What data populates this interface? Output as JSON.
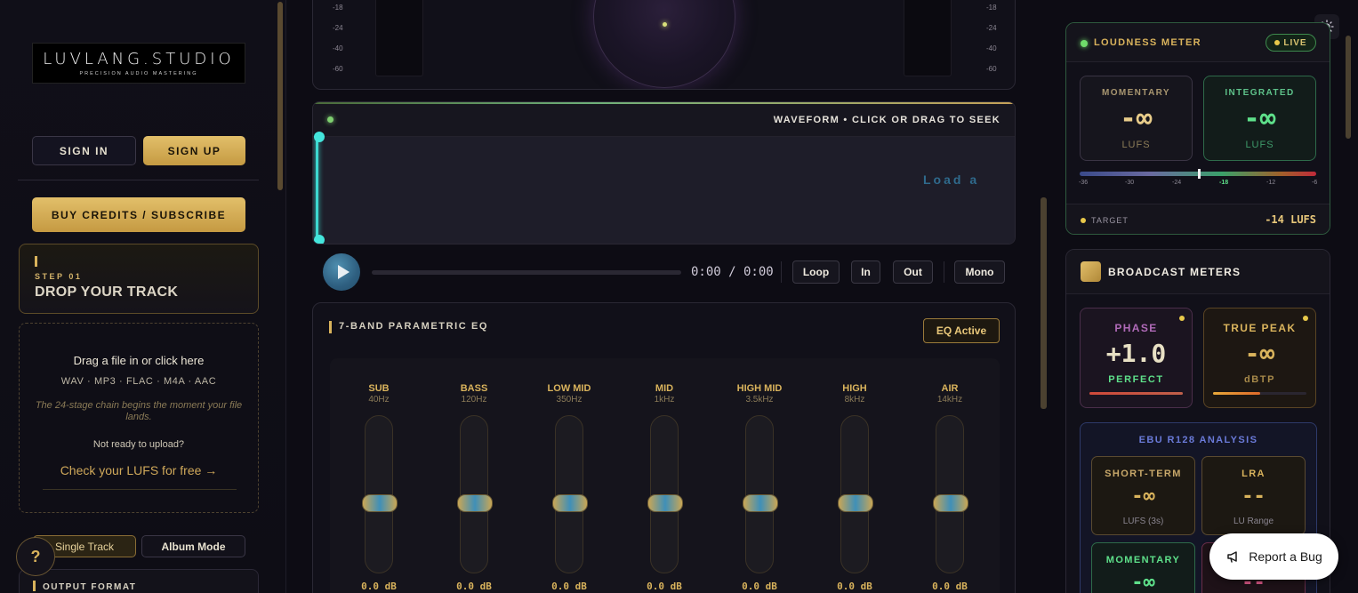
{
  "sidebar": {
    "logo_text": "LUVLANG.STUDIO",
    "logo_sub": "PRECISION AUDIO MASTERING",
    "sign_in": "SIGN IN",
    "sign_up": "SIGN UP",
    "buy_credits": "BUY CREDITS / SUBSCRIBE",
    "step_label": "STEP 01",
    "step_title": "DROP YOUR TRACK",
    "drop_title": "Drag a file in or click here",
    "drop_formats": "WAV · MP3 · FLAC · M4A · AAC",
    "drop_note": "The 24-stage chain begins the moment your file lands.",
    "drop_ready": "Not ready to upload?",
    "drop_link": "Check your LUFS for free →",
    "help": "?",
    "single_track": "Single Track",
    "album_mode": "Album Mode",
    "output_format": "OUTPUT FORMAT"
  },
  "meters": {
    "scale_left": [
      "-18",
      "-24",
      "-40",
      "-60"
    ],
    "scale_right": [
      "-18",
      "-24",
      "-40",
      "-60"
    ]
  },
  "waveform": {
    "title": "WAVEFORM • CLICK OR DRAG TO SEEK",
    "load_text": "Load a"
  },
  "transport": {
    "time": "0:00 / 0:00",
    "loop": "Loop",
    "in": "In",
    "out": "Out",
    "mono": "Mono"
  },
  "eq": {
    "title": "7-BAND PARAMETRIC EQ",
    "status": "EQ Active",
    "bands": [
      {
        "name": "SUB",
        "freq": "40Hz",
        "value": "0.0 dB"
      },
      {
        "name": "BASS",
        "freq": "120Hz",
        "value": "0.0 dB"
      },
      {
        "name": "LOW MID",
        "freq": "350Hz",
        "value": "0.0 dB"
      },
      {
        "name": "MID",
        "freq": "1kHz",
        "value": "0.0 dB"
      },
      {
        "name": "HIGH MID",
        "freq": "3.5kHz",
        "value": "0.0 dB"
      },
      {
        "name": "HIGH",
        "freq": "8kHz",
        "value": "0.0 dB"
      },
      {
        "name": "AIR",
        "freq": "14kHz",
        "value": "0.0 dB"
      }
    ]
  },
  "loudness": {
    "title": "LOUDNESS METER",
    "live": "LIVE",
    "momentary_label": "MOMENTARY",
    "momentary_value": "-∞",
    "momentary_unit": "LUFS",
    "integrated_label": "INTEGRATED",
    "integrated_value": "-∞",
    "integrated_unit": "LUFS",
    "scale_ticks": [
      "-36",
      "-30",
      "-24",
      "-18",
      "-12",
      "-6"
    ],
    "target_label": "TARGET",
    "target_value": "-14 LUFS"
  },
  "broadcast": {
    "title": "BROADCAST METERS",
    "phase_label": "PHASE",
    "phase_value": "+1.0",
    "phase_status": "PERFECT",
    "truepeak_label": "TRUE PEAK",
    "truepeak_value": "-∞",
    "truepeak_unit": "dBTP",
    "ebu_title": "EBU R128 ANALYSIS",
    "short_term_label": "SHORT-TERM",
    "short_term_value": "-∞",
    "short_term_unit": "LUFS (3s)",
    "lra_label": "LRA",
    "lra_value": "--",
    "lra_unit": "LU Range",
    "momentary_label": "MOMENTARY",
    "momentary_value": "-∞",
    "fourth_value": "--"
  },
  "report_bug": "Report a Bug",
  "colors": {
    "gold": "#d9b35c",
    "green": "#5ee08a",
    "cyan": "#3ed8d0"
  }
}
